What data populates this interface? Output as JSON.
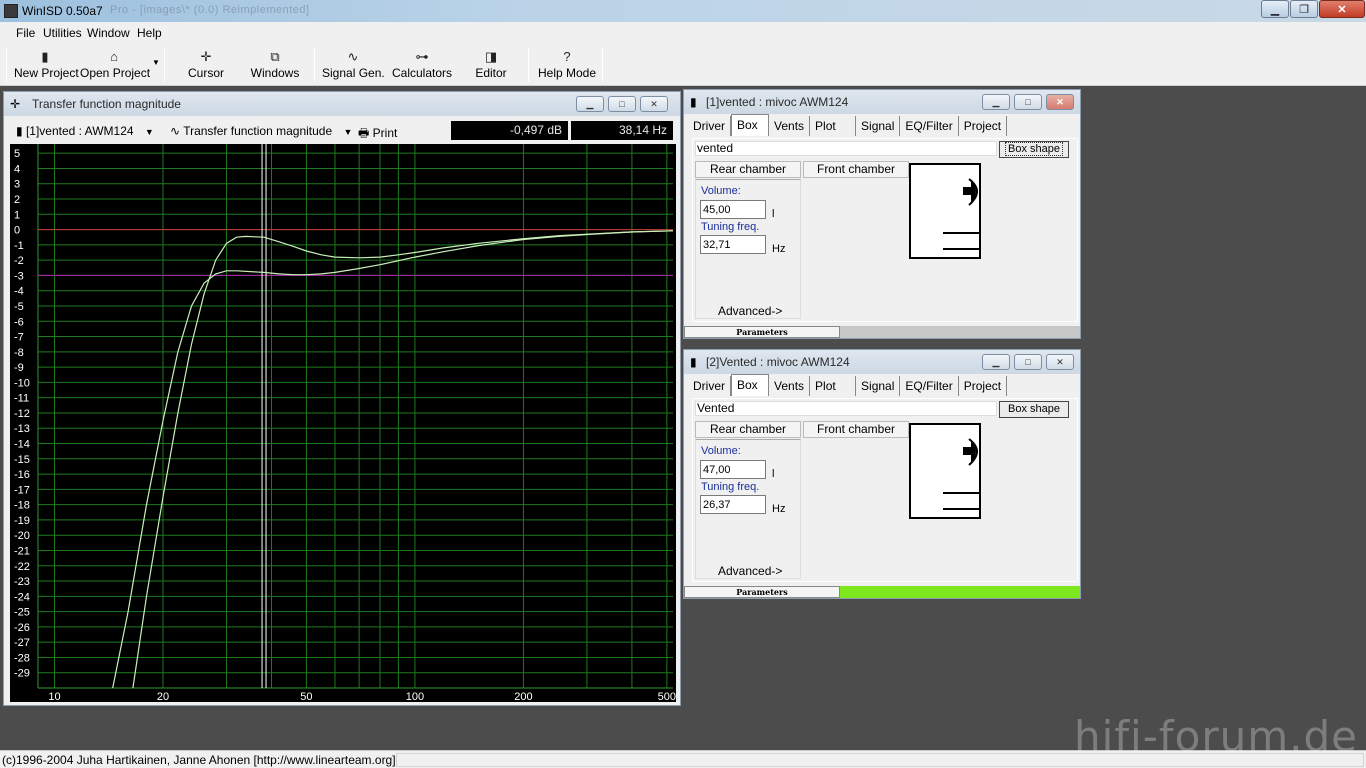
{
  "app": {
    "title": "WinISD 0.50a7",
    "blurred_title": "Pro - [images\\* (0.0) Reimplemented]"
  },
  "menu": [
    "File",
    "Utilities",
    "Window",
    "Help"
  ],
  "toolbar": [
    {
      "label": "New Project",
      "icon": "new-project-icon"
    },
    {
      "label": "Open Project",
      "icon": "open-project-icon"
    },
    {
      "label": "Cursor",
      "icon": "cursor-icon"
    },
    {
      "label": "Windows",
      "icon": "windows-icon"
    },
    {
      "label": "Signal Gen.",
      "icon": "signal-generator-icon"
    },
    {
      "label": "Calculators",
      "icon": "calculators-icon"
    },
    {
      "label": "Editor",
      "icon": "editor-icon"
    },
    {
      "label": "Help Mode",
      "icon": "help-mode-icon"
    }
  ],
  "graph": {
    "title": "Transfer function magnitude",
    "project_select": "[1]vented : AWM124",
    "plot_select": "Transfer function magnitude",
    "print": "Print",
    "readout_db": "-0,497 dB",
    "readout_hz": "38,14 Hz",
    "colors": {
      "background": "#000000",
      "grid": "#1f7a1f",
      "curve": "#c8f0b8",
      "ref0": "#d03030",
      "ref3": "#b020b0"
    }
  },
  "chart_data": {
    "type": "line",
    "title": "Transfer function magnitude",
    "xscale": "log",
    "xlim": [
      9,
      520
    ],
    "ylim": [
      -30,
      5.6
    ],
    "x_tick_labels": [
      "10",
      "20",
      "50",
      "100",
      "200",
      "500"
    ],
    "y_tick_labels": [
      "5",
      "4",
      "3",
      "2",
      "1",
      "0",
      "-1",
      "-2",
      "-3",
      "-4",
      "-5",
      "-6",
      "-7",
      "-8",
      "-9",
      "-10",
      "-11",
      "-12",
      "-13",
      "-14",
      "-15",
      "-16",
      "-17",
      "-18",
      "-19",
      "-20",
      "-21",
      "-22",
      "-23",
      "-24",
      "-25",
      "-26",
      "-27",
      "-28",
      "-29"
    ],
    "cursor_x": 38.14,
    "reference_lines": [
      0,
      -3
    ],
    "series": [
      {
        "x": [
          16.5,
          18,
          20,
          22,
          24,
          26,
          28,
          30,
          32,
          34,
          36,
          38.14,
          42,
          46,
          50,
          55,
          60,
          70,
          80,
          90,
          100,
          120,
          150,
          200,
          250,
          300,
          400,
          520
        ],
        "y": [
          -30,
          -24,
          -17.5,
          -12,
          -7.5,
          -4.2,
          -2,
          -0.9,
          -0.5,
          -0.45,
          -0.47,
          -0.497,
          -0.8,
          -1.1,
          -1.4,
          -1.65,
          -1.8,
          -1.85,
          -1.8,
          -1.65,
          -1.5,
          -1.2,
          -0.9,
          -0.6,
          -0.4,
          -0.3,
          -0.15,
          -0.08
        ]
      },
      {
        "x": [
          14.5,
          16,
          18,
          20,
          22,
          24,
          26,
          28,
          30,
          32,
          35,
          38,
          42,
          46,
          50,
          55,
          60,
          70,
          80,
          100,
          120,
          150,
          200,
          250,
          300,
          400,
          520
        ],
        "y": [
          -30,
          -25,
          -18,
          -12.5,
          -8,
          -5,
          -3.5,
          -2.9,
          -2.7,
          -2.7,
          -2.75,
          -2.8,
          -2.9,
          -2.95,
          -2.95,
          -2.9,
          -2.8,
          -2.55,
          -2.3,
          -1.8,
          -1.45,
          -1.05,
          -0.65,
          -0.45,
          -0.32,
          -0.16,
          -0.08
        ]
      }
    ]
  },
  "box1": {
    "title": "[1]vented : mivoc AWM124",
    "tabs": [
      "Driver",
      "Box",
      "Vents",
      "Plot",
      "Signal",
      "EQ/Filter",
      "Project"
    ],
    "type": "vented",
    "shape_button": "Box shape",
    "rear": "Rear chamber",
    "front": "Front chamber",
    "volume_label": "Volume:",
    "volume": "45,00",
    "volume_unit": "l",
    "tuning_label": "Tuning freq.",
    "tuning": "32,71",
    "tuning_unit": "Hz",
    "advanced": "Advanced->",
    "params": "Parameters",
    "progress": 0
  },
  "box2": {
    "title": "[2]Vented : mivoc AWM124",
    "tabs": [
      "Driver",
      "Box",
      "Vents",
      "Plot",
      "Signal",
      "EQ/Filter",
      "Project"
    ],
    "type": "Vented",
    "shape_button": "Box shape",
    "rear": "Rear chamber",
    "front": "Front chamber",
    "volume_label": "Volume:",
    "volume": "47,00",
    "volume_unit": "l",
    "tuning_label": "Tuning freq.",
    "tuning": "26,37",
    "tuning_unit": "Hz",
    "advanced": "Advanced->",
    "params": "Parameters",
    "progress": 1,
    "progress_color": "#7ee81f"
  },
  "status": "(c)1996-2004 Juha Hartikainen, Janne Ahonen [http://www.linearteam.org]",
  "watermark": "hifi-forum.de"
}
